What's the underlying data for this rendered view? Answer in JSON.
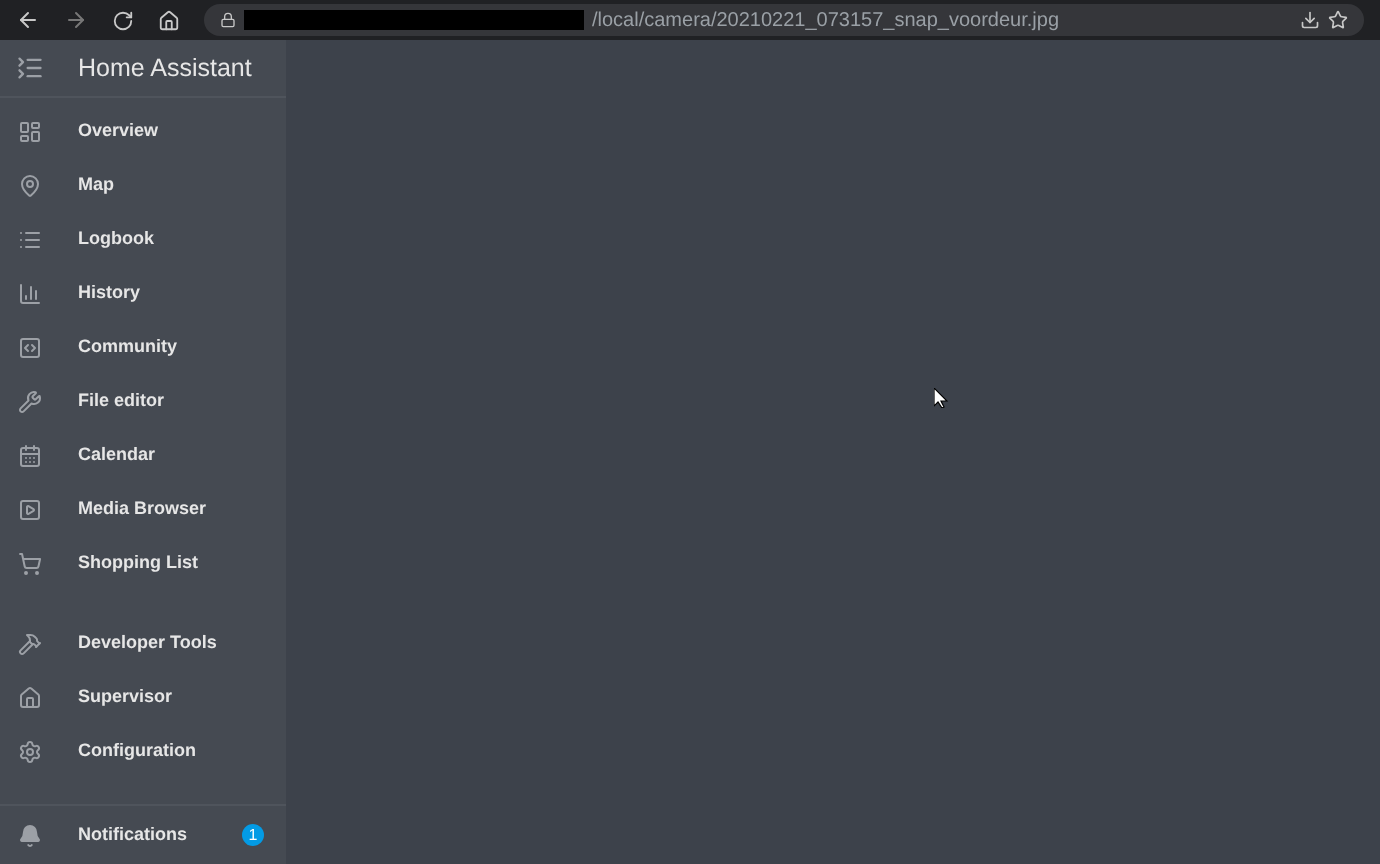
{
  "browser": {
    "url": "/local/camera/20210221_073157_snap_voordeur.jpg"
  },
  "sidebar": {
    "title": "Home Assistant",
    "groups": [
      {
        "items": [
          {
            "label": "Overview"
          },
          {
            "label": "Map"
          },
          {
            "label": "Logbook"
          },
          {
            "label": "History"
          },
          {
            "label": "Community"
          },
          {
            "label": "File editor"
          },
          {
            "label": "Calendar"
          },
          {
            "label": "Media Browser"
          },
          {
            "label": "Shopping List"
          }
        ]
      },
      {
        "items": [
          {
            "label": "Developer Tools"
          },
          {
            "label": "Supervisor"
          },
          {
            "label": "Configuration"
          }
        ]
      }
    ],
    "notifications": {
      "label": "Notifications",
      "badge": "1"
    }
  }
}
